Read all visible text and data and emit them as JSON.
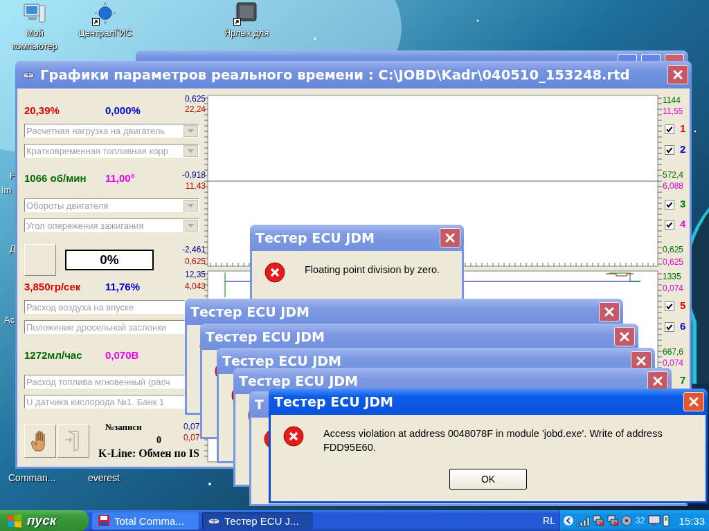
{
  "desktop": {
    "icons": [
      {
        "label": "Мой компьютер",
        "kind": "computer",
        "shortcut": false
      },
      {
        "label": "ЦентралГИС",
        "kind": "globe",
        "shortcut": true
      },
      {
        "label": "Ярлык для",
        "kind": "gis",
        "shortcut": true
      }
    ],
    "edge_labels": [
      "F",
      "Im",
      "Д",
      "Ac"
    ],
    "bottom_labels": [
      "Comman...",
      "everest"
    ]
  },
  "main_window": {
    "title": "Графики параметров реального времени : C:\\JOBD\\Kadr\\040510_153248.rtd",
    "groups": [
      {
        "readings": [
          {
            "text": "20,39%",
            "color": "#e00000"
          },
          {
            "text": "0,000%",
            "color": "#0000d0"
          }
        ],
        "fields": [
          {
            "label": "Расчетная нагрузка на двигатель",
            "disabled": true
          },
          {
            "label": "Кратковременная топливная корр",
            "disabled": true
          }
        ]
      },
      {
        "readings": [
          {
            "text": "1066 об/мин",
            "color": "#006e00"
          },
          {
            "text": "11,00°",
            "color": "#ee00ee"
          }
        ],
        "fields": [
          {
            "label": "Обороты двигателя",
            "disabled": true
          },
          {
            "label": "Угол опережения зажигания",
            "disabled": true
          }
        ]
      },
      {
        "readings": [
          {
            "text": "3,850гр/сек",
            "color": "#e00000"
          },
          {
            "text": "11,76%",
            "color": "#0000d0"
          }
        ],
        "fields": [
          {
            "label": "Расход воздуха на впуске",
            "disabled": true
          },
          {
            "label": "Положение дросельной заслонки",
            "disabled": true
          }
        ]
      },
      {
        "readings": [
          {
            "text": "1272мл/час",
            "color": "#006e00"
          },
          {
            "text": "0,070В",
            "color": "#ee00ee"
          }
        ],
        "fields": [
          {
            "label": "Расход топлива мгновенный (расч",
            "disabled": true
          },
          {
            "label": "U датчика кислорода №1. Банк 1",
            "disabled": true
          }
        ]
      }
    ],
    "percent": "0%",
    "record_label": "№записи",
    "record_number": "0",
    "status": "K-Line:  Обмен по IS",
    "chart": {
      "left_labels": [
        {
          "text": "0,625",
          "color": "#0000a0"
        },
        {
          "text": "22,24",
          "color": "#c00000"
        },
        {
          "text": "-0,918",
          "color": "#0000a0"
        },
        {
          "text": "11,43",
          "color": "#c00000"
        },
        {
          "text": "-2,461",
          "color": "#0000a0"
        },
        {
          "text": "0,625",
          "color": "#c00000"
        },
        {
          "text": "12,35",
          "color": "#0000a0"
        },
        {
          "text": "4,043",
          "color": "#c00000"
        },
        {
          "text": "0,07",
          "color": "#0000a0"
        },
        {
          "text": "0,07",
          "color": "#c00000"
        }
      ],
      "right_items": [
        {
          "kind": "label",
          "text": "1144",
          "color": "#007000"
        },
        {
          "kind": "label",
          "text": "11,55",
          "color": "#e000e0"
        },
        {
          "kind": "checkbox",
          "label": "1",
          "color": "#e00000",
          "checked": true
        },
        {
          "kind": "checkbox",
          "label": "2",
          "color": "#0000e0",
          "checked": true
        },
        {
          "kind": "label",
          "text": "572,4",
          "color": "#007000"
        },
        {
          "kind": "label",
          "text": "6,088",
          "color": "#e000e0"
        },
        {
          "kind": "checkbox",
          "label": "3",
          "color": "#008000",
          "checked": true
        },
        {
          "kind": "checkbox",
          "label": "4",
          "color": "#ff00ff",
          "checked": true
        },
        {
          "kind": "label",
          "text": "0,625",
          "color": "#007000"
        },
        {
          "kind": "label",
          "text": "0,625",
          "color": "#e000e0"
        },
        {
          "kind": "label",
          "text": "1335",
          "color": "#007000"
        },
        {
          "kind": "label",
          "text": "0,074",
          "color": "#e000e0"
        },
        {
          "kind": "checkbox",
          "label": "5",
          "color": "#e00000",
          "checked": true
        },
        {
          "kind": "checkbox",
          "label": "6",
          "color": "#0000e0",
          "checked": true
        },
        {
          "kind": "label",
          "text": "667,6",
          "color": "#007000"
        },
        {
          "kind": "label",
          "text": "0,074",
          "color": "#e000e0"
        },
        {
          "kind": "channel",
          "text": "7",
          "color": "#008000"
        }
      ]
    }
  },
  "dialogs": [
    {
      "title": "Тестер ECU JDM",
      "message": "Floating point division by zero.",
      "active": false
    },
    {
      "title": "Тестер ECU JDM",
      "active": false
    },
    {
      "title": "Тестер ECU JDM",
      "active": false
    },
    {
      "title": "Тестер ECU JDM",
      "active": false
    },
    {
      "title": "Тестер ECU JDM",
      "active": false
    },
    {
      "title": "Т",
      "active": false
    },
    {
      "title": "Тестер ECU JDM",
      "message": "Access violation at address 0048078F in module 'jobd.exe'. Write of address FDD95E60.",
      "button": "OK",
      "active": true
    }
  ],
  "taskbar": {
    "start": "пуск",
    "tasks": [
      {
        "label": "Total Comma...",
        "selected": false
      },
      {
        "label": "Тестер ECU J...",
        "selected": true
      }
    ],
    "language": "RL",
    "tray_number": "32",
    "clock": "15:33"
  }
}
